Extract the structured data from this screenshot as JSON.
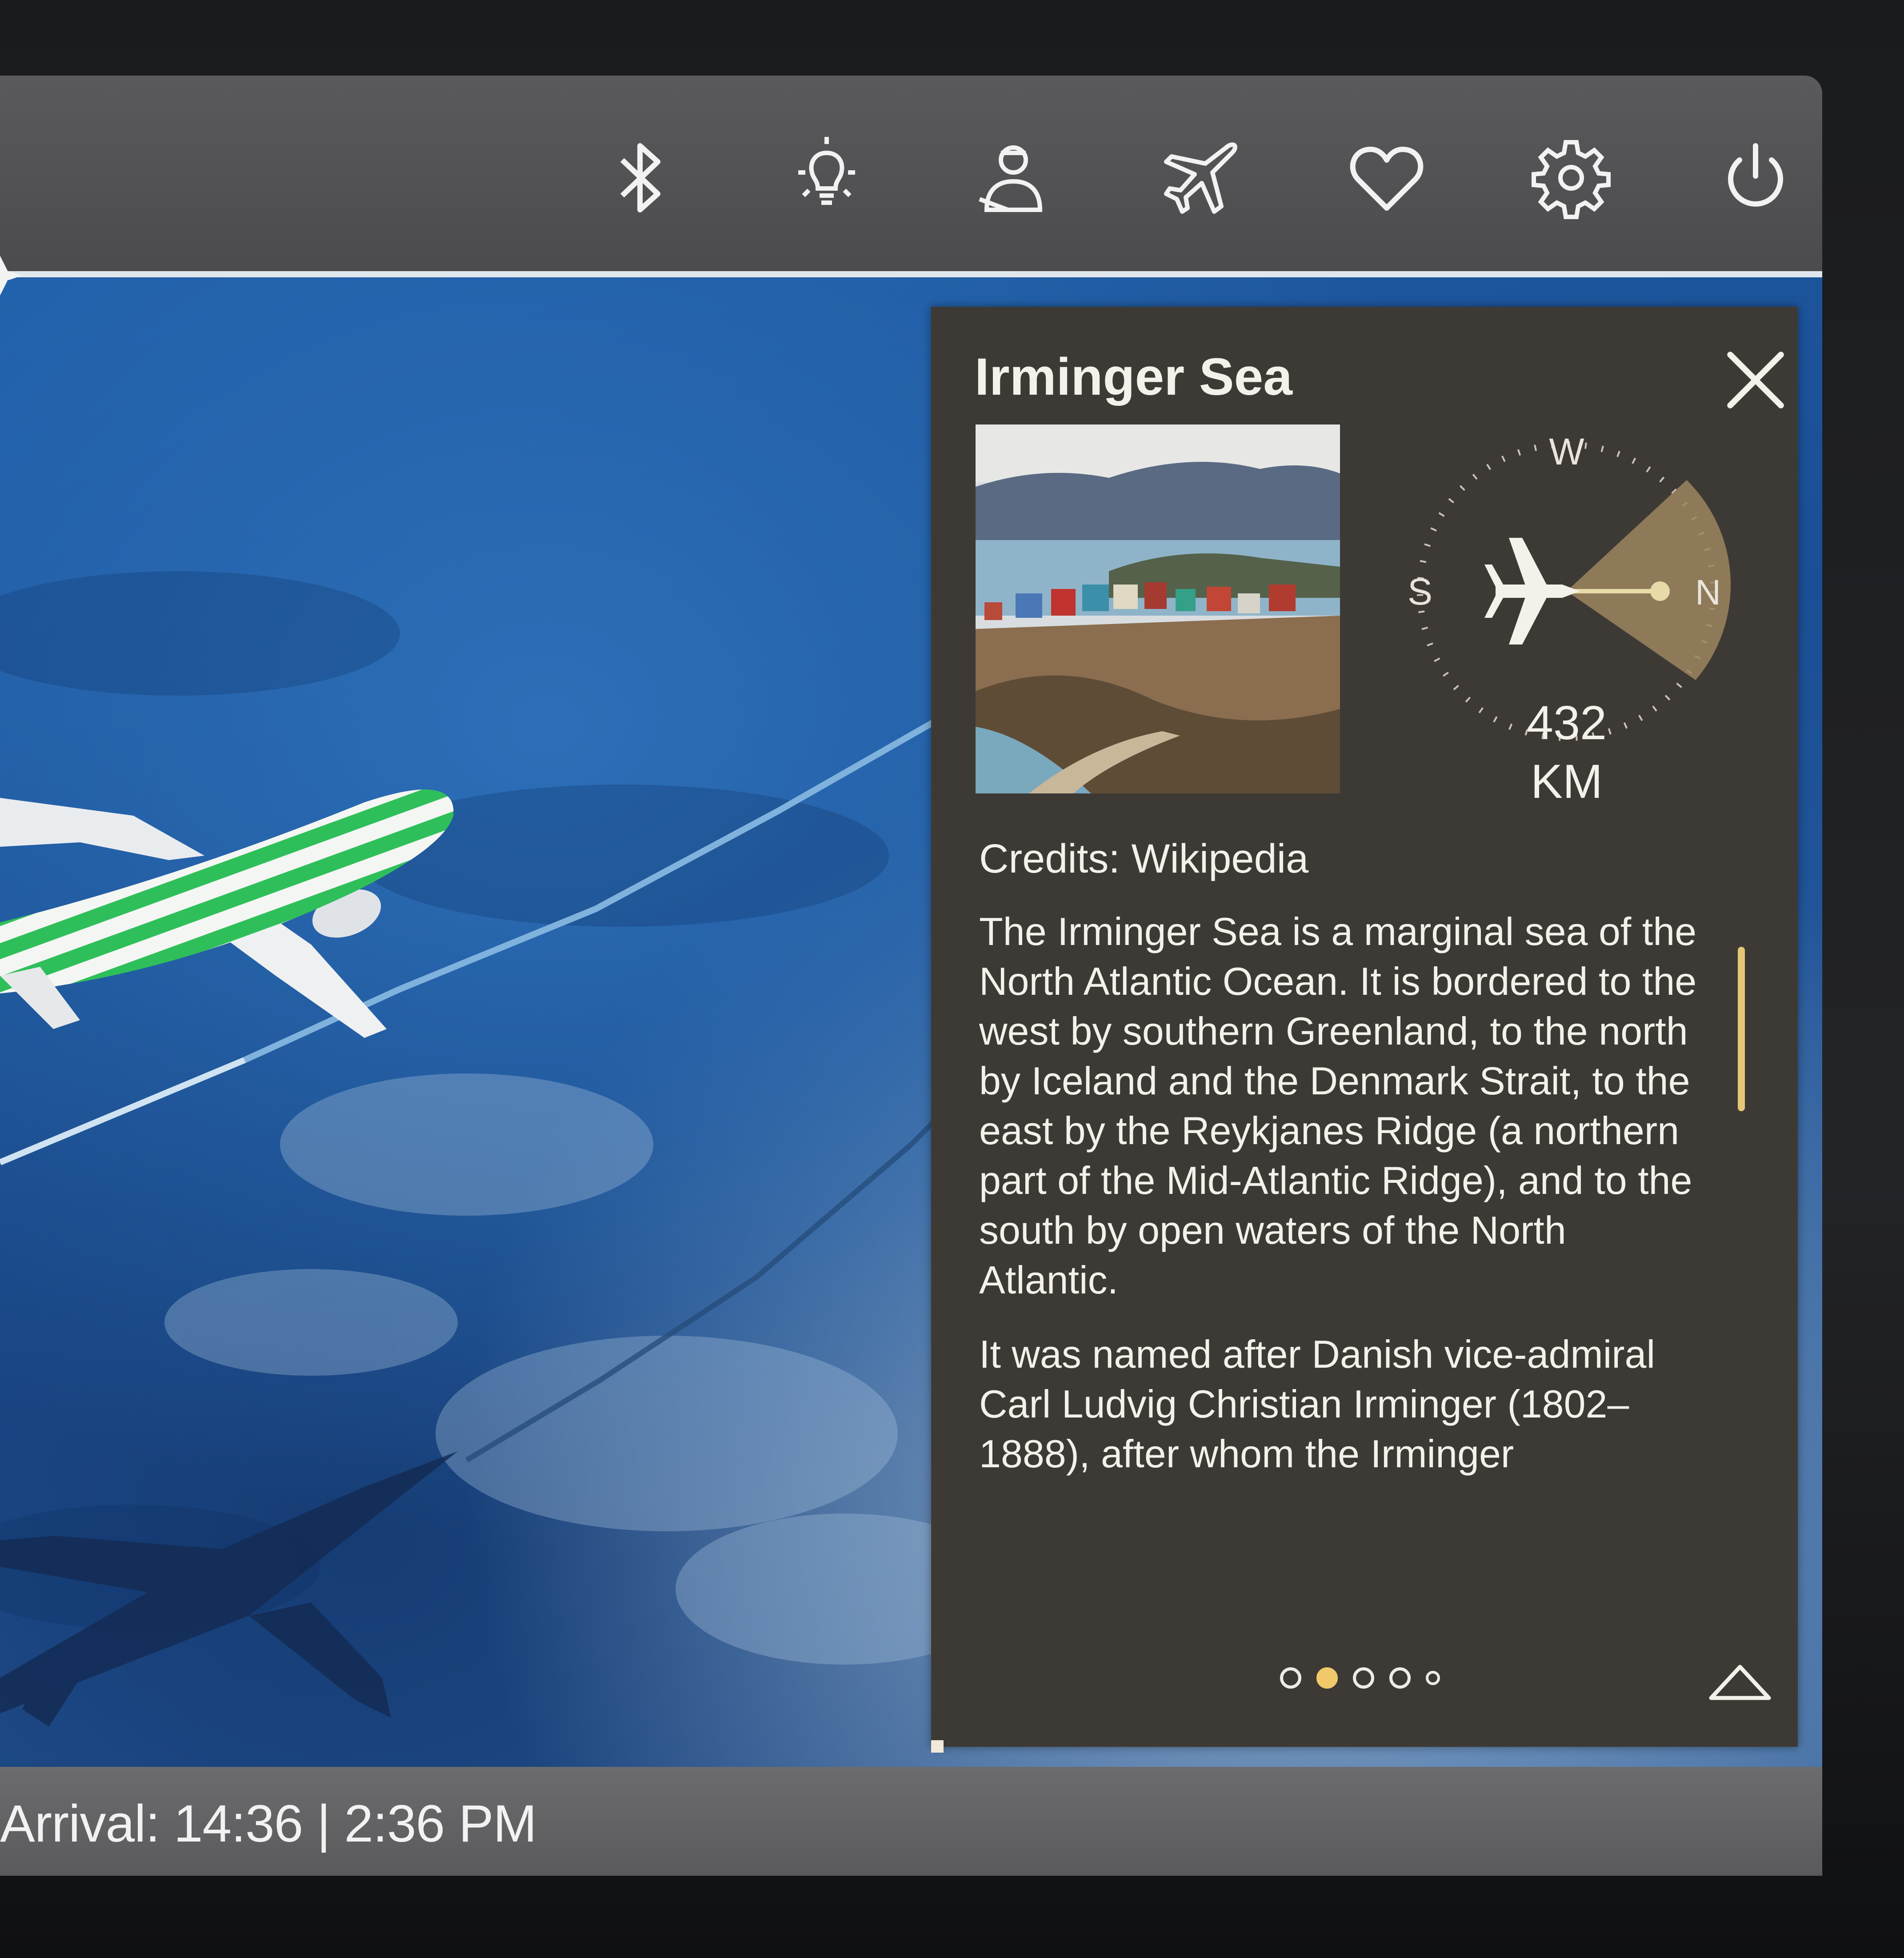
{
  "toolbar": {
    "icons": [
      "bluetooth-icon",
      "reading-light-icon",
      "call-attendant-icon",
      "flight-icon",
      "favorites-icon",
      "settings-icon",
      "power-icon"
    ]
  },
  "info_panel": {
    "title": "Irminger Sea",
    "compass": {
      "labels": {
        "west": "W",
        "south": "S",
        "north": "N"
      },
      "distance_value": "432",
      "distance_unit": "KM",
      "accent": "#b59a6a"
    },
    "credits": "Credits: Wikipedia",
    "paragraphs": [
      "The Irminger Sea is a marginal sea of the North Atlantic Ocean. It is bordered to the west by southern Greenland, to the north by Iceland and the Denmark Strait, to the east by the Reykjanes Ridge (a northern part of the Mid-Atlantic Ridge), and to the south by open waters of the North Atlantic.",
      "It was named after Danish vice-admiral Carl Ludvig Christian Irminger (1802–1888), after whom the Irminger"
    ],
    "pager": {
      "pages": 5,
      "active_page": 2
    }
  },
  "footer": {
    "arrival": "Arrival: 14:36 |  2:36 PM"
  },
  "colors": {
    "panel_bg": "#3d3a35",
    "accent_gold": "#f1c96b",
    "aircraft_stripe": "#2fbf5a"
  }
}
